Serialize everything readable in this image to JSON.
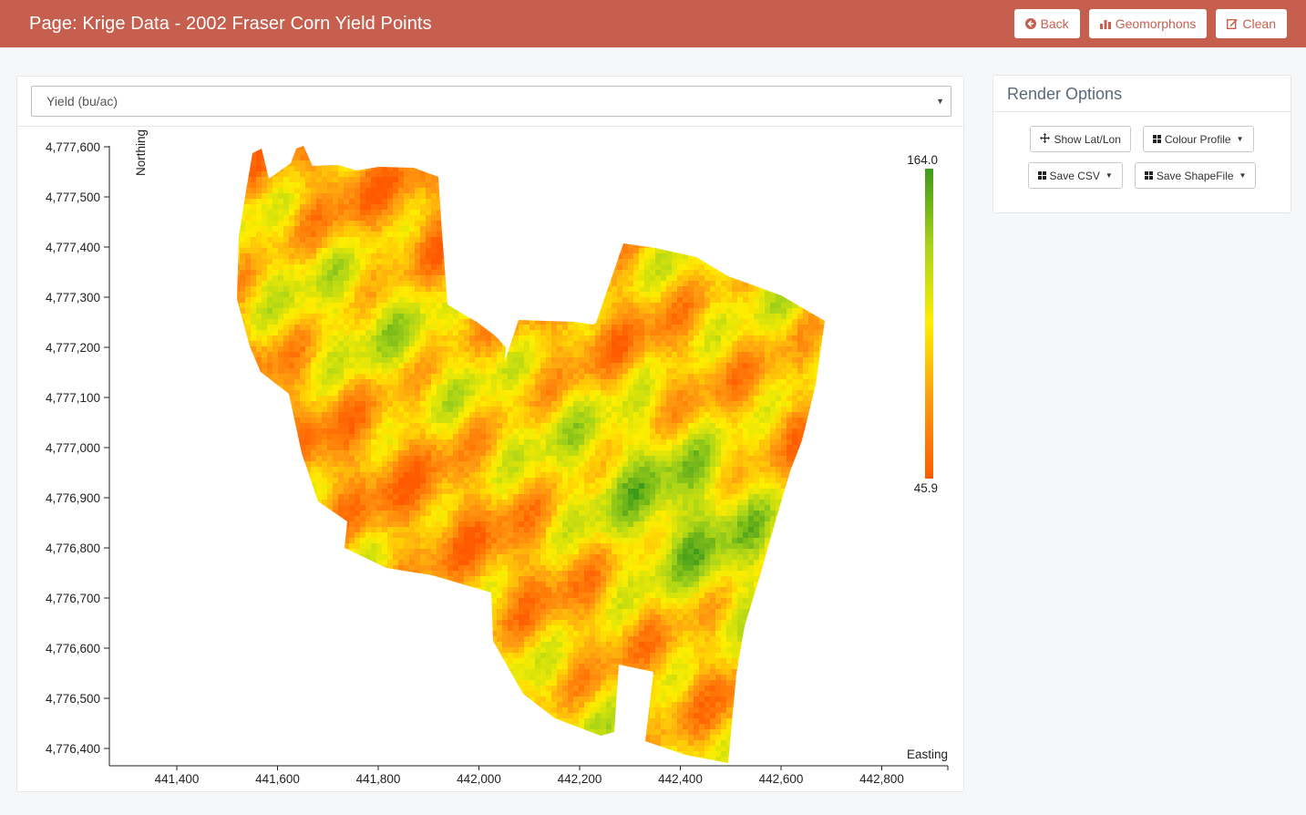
{
  "header": {
    "title": "Page: Krige Data - 2002 Fraser Corn Yield Points",
    "buttons": [
      {
        "label": "Back",
        "icon": "arrow-circle-left-icon"
      },
      {
        "label": "Geomorphons",
        "icon": "bar-chart-icon"
      },
      {
        "label": "Clean",
        "icon": "edit-icon"
      }
    ]
  },
  "map": {
    "layer_select": {
      "selected": "Yield (bu/ac)"
    },
    "axes": {
      "x_label": "Easting",
      "y_label": "Northing",
      "x_ticks": [
        "441,400",
        "441,600",
        "441,800",
        "442,000",
        "442,200",
        "442,400",
        "442,600",
        "442,800"
      ],
      "y_ticks": [
        "4,777,600",
        "4,777,500",
        "4,777,400",
        "4,777,300",
        "4,777,200",
        "4,777,100",
        "4,777,000",
        "4,776,900",
        "4,776,800",
        "4,776,700",
        "4,776,600",
        "4,776,500",
        "4,776,400"
      ]
    },
    "legend": {
      "max": "164.0",
      "min": "45.9"
    },
    "colors": {
      "low": "#ff5a00",
      "mid_low": "#ff9a10",
      "mid": "#ffee00",
      "mid_high": "#a8d418",
      "high": "#3d9a1c"
    }
  },
  "render_options": {
    "title": "Render Options",
    "buttons": [
      {
        "label": "Show Lat/Lon",
        "icon": "arrows-icon",
        "dropdown": false
      },
      {
        "label": "Colour Profile",
        "icon": "grid-icon",
        "dropdown": true
      },
      {
        "label": "Save CSV",
        "icon": "grid-icon",
        "dropdown": true
      },
      {
        "label": "Save ShapeFile",
        "icon": "grid-icon",
        "dropdown": true
      }
    ]
  }
}
